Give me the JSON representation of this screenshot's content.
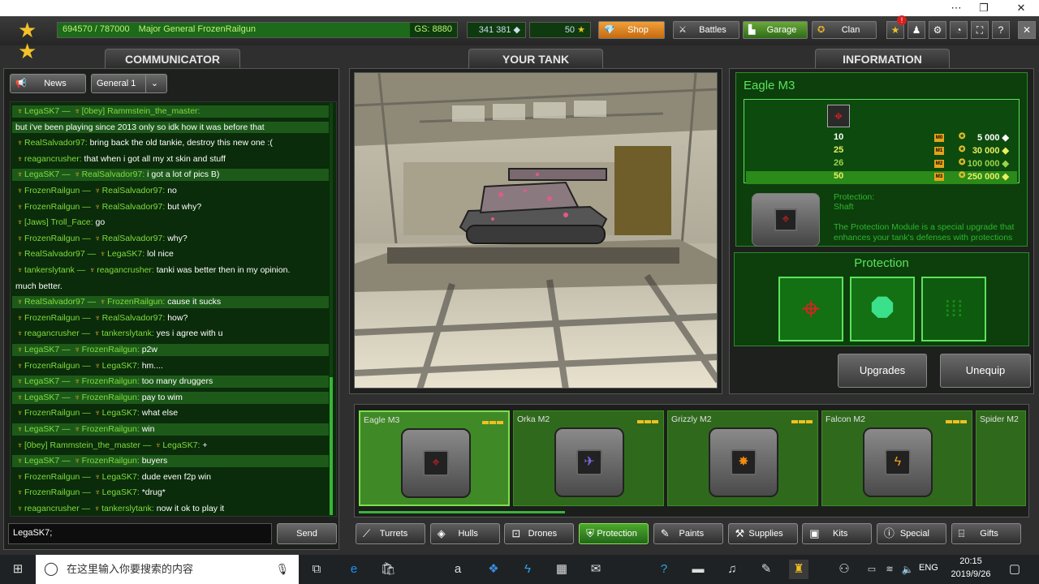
{
  "topbar": {
    "rank_progress_text": "694570 / 787000",
    "rank_title": "Major General FrozenRailgun",
    "gs": "GS: 8880",
    "crystals": "341 381",
    "stars": "50",
    "rank_fraction": 0.8826,
    "nav": {
      "shop": "Shop",
      "battles": "Battles",
      "garage": "Garage",
      "clan": "Clan"
    },
    "notification_count": "!"
  },
  "panels": {
    "communicator": "COMMUNICATOR",
    "your_tank": "YOUR TANK",
    "information": "INFORMATION"
  },
  "communicator": {
    "news": "News",
    "channel": "General 1",
    "input": "LegaSK7;",
    "send": "Send",
    "messages": [
      {
        "from": "LegaSK7",
        "to": "[0bey] Rammstein_the_master:",
        "text": "",
        "hl": true
      },
      {
        "from": "",
        "to": "",
        "text": "but i've been playing since 2013 only so idk how it was before that",
        "hl": true
      },
      {
        "from": "RealSalvador97:",
        "to": "",
        "text": "bring back the old tankie, destroy this new one :(",
        "hl": false
      },
      {
        "from": "reagancrusher:",
        "to": "",
        "text": "that when i got all my xt skin and stuff",
        "hl": false
      },
      {
        "from": "LegaSK7",
        "to": "RealSalvador97:",
        "text": "i got a lot of pics B)",
        "hl": true
      },
      {
        "from": "FrozenRailgun",
        "to": "RealSalvador97:",
        "text": "no",
        "hl": false
      },
      {
        "from": "FrozenRailgun",
        "to": "RealSalvador97:",
        "text": "but why?",
        "hl": false
      },
      {
        "from": "[Jaws] Troll_Face:",
        "to": "",
        "text": "go",
        "hl": false
      },
      {
        "from": "FrozenRailgun",
        "to": "RealSalvador97:",
        "text": "why?",
        "hl": false
      },
      {
        "from": "RealSalvador97",
        "to": "LegaSK7:",
        "text": "lol nice",
        "hl": false
      },
      {
        "from": "tankerslytank",
        "to": "reagancrusher:",
        "text": "tanki was better then in my opinion.",
        "hl": false
      },
      {
        "from": "",
        "to": "",
        "text": "much better.",
        "hl": false
      },
      {
        "from": "RealSalvador97",
        "to": "FrozenRailgun:",
        "text": "cause it sucks",
        "hl": true
      },
      {
        "from": "FrozenRailgun",
        "to": "RealSalvador97:",
        "text": "how?",
        "hl": false
      },
      {
        "from": "reagancrusher",
        "to": "tankerslytank:",
        "text": "yes i agree with u",
        "hl": false
      },
      {
        "from": "LegaSK7",
        "to": "FrozenRailgun:",
        "text": "p2w",
        "hl": true
      },
      {
        "from": "FrozenRailgun",
        "to": "LegaSK7:",
        "text": "hm....",
        "hl": false
      },
      {
        "from": "LegaSK7",
        "to": "FrozenRailgun:",
        "text": "too many druggers",
        "hl": true
      },
      {
        "from": "LegaSK7",
        "to": "FrozenRailgun:",
        "text": "pay to wim",
        "hl": true
      },
      {
        "from": "FrozenRailgun",
        "to": "LegaSK7:",
        "text": "what else",
        "hl": false
      },
      {
        "from": "LegaSK7",
        "to": "FrozenRailgun:",
        "text": "win",
        "hl": true
      },
      {
        "from": "[0bey] Rammstein_the_master",
        "to": "LegaSK7:",
        "text": "+",
        "hl": false
      },
      {
        "from": "LegaSK7",
        "to": "FrozenRailgun:",
        "text": "buyers",
        "hl": true
      },
      {
        "from": "FrozenRailgun",
        "to": "LegaSK7:",
        "text": "dude even f2p win",
        "hl": false
      },
      {
        "from": "FrozenRailgun",
        "to": "LegaSK7:",
        "text": "*drug*",
        "hl": false
      },
      {
        "from": "reagancrusher",
        "to": "tankerslytank:",
        "text": "now it ok to play it",
        "hl": false
      }
    ]
  },
  "info": {
    "title": "Eagle M3",
    "upgrades": [
      {
        "level": "10",
        "mark": "M0",
        "price": "5 000",
        "active": false
      },
      {
        "level": "25",
        "mark": "M1",
        "price": "30 000",
        "active": false
      },
      {
        "level": "26",
        "mark": "M2",
        "price": "100 000",
        "active": false
      },
      {
        "level": "50",
        "mark": "M3",
        "price": "250 000",
        "active": true
      }
    ],
    "protection_label": "Protection:",
    "protection_value": "Shaft",
    "description": "The Protection Module is a special upgrade that enhances your tank's defenses with protections",
    "slots_title": "Protection",
    "upgrades_btn": "Upgrades",
    "unequip_btn": "Unequip"
  },
  "garage_items": [
    {
      "name": "Eagle M3",
      "glyph": "⌖",
      "color": "#e02020",
      "selected": true
    },
    {
      "name": "Orka M2",
      "glyph": "✈",
      "color": "#7a6ae0",
      "selected": false
    },
    {
      "name": "Grizzly M2",
      "glyph": "✸",
      "color": "#f08a10",
      "selected": false
    },
    {
      "name": "Falcon M2",
      "glyph": "ϟ",
      "color": "#f0a010",
      "selected": false
    },
    {
      "name": "Spider M2",
      "glyph": "",
      "color": "#888",
      "selected": false
    }
  ],
  "categories": [
    {
      "label": "Turrets",
      "icon": "turret-icon",
      "glyph": "⟋"
    },
    {
      "label": "Hulls",
      "icon": "hull-icon",
      "glyph": "◈"
    },
    {
      "label": "Drones",
      "icon": "drone-icon",
      "glyph": "⊡"
    },
    {
      "label": "Protection",
      "icon": "shield-icon",
      "glyph": "⛨"
    },
    {
      "label": "Paints",
      "icon": "paint-icon",
      "glyph": "✎"
    },
    {
      "label": "Supplies",
      "icon": "wrench-icon",
      "glyph": "⚒"
    },
    {
      "label": "Kits",
      "icon": "kit-icon",
      "glyph": "▣"
    },
    {
      "label": "Special",
      "icon": "alert-icon",
      "glyph": "ⓘ"
    },
    {
      "label": "Gifts",
      "icon": "gift-icon",
      "glyph": "⌸"
    }
  ],
  "taskbar": {
    "search_placeholder": "在这里输入你要搜索的内容",
    "time": "20:15",
    "date": "2019/9/26",
    "lang": "ENG"
  },
  "colors": {
    "accent_green": "#5ce25c",
    "panel_green": "#0c3f0c",
    "shop_orange": "#e08a28"
  }
}
